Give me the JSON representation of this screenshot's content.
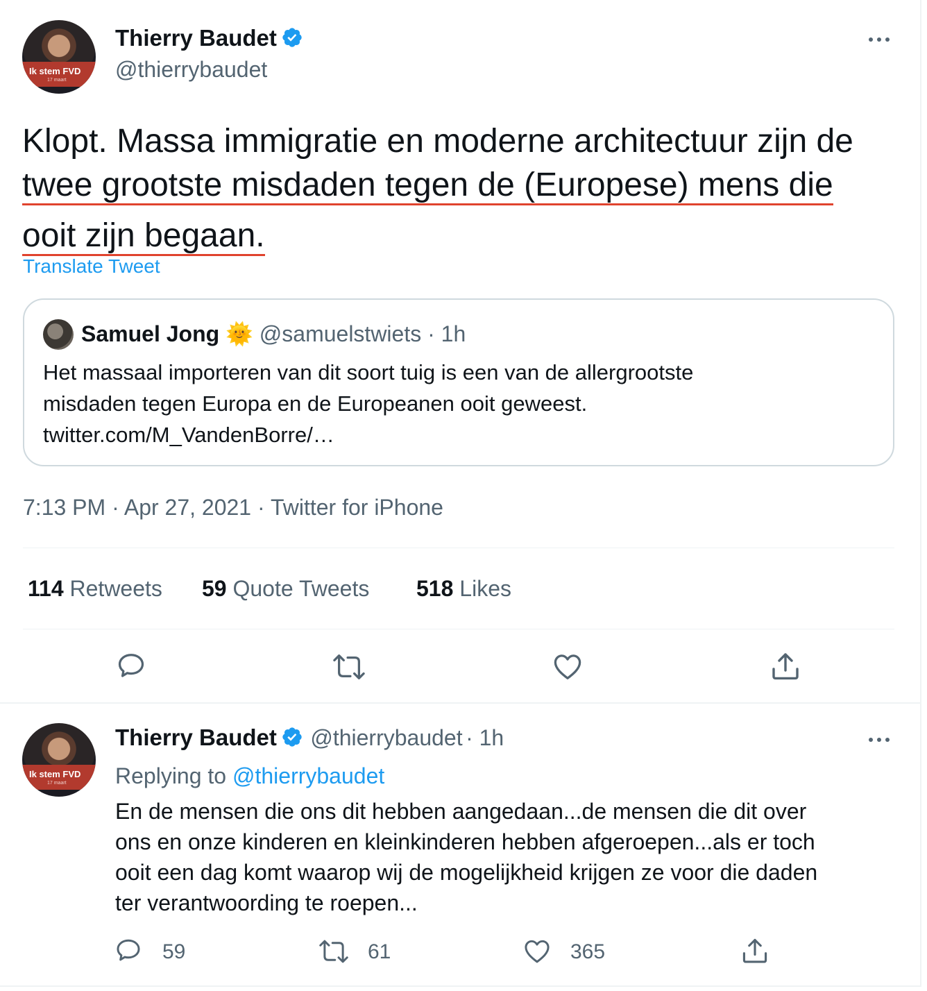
{
  "tweet": {
    "author": {
      "name": "Thierry Baudet",
      "handle": "@thierrybaudet",
      "avatar_text": "Ik stem FVD",
      "avatar_subtext": "17 maart"
    },
    "text_lines": [
      "Klopt. Massa immigratie en moderne architectuur zijn de",
      "twee grootste misdaden tegen de (Europese) mens die",
      "ooit zijn begaan."
    ],
    "translate_label": "Translate Tweet",
    "quote": {
      "name": "Samuel Jong",
      "emoji": "🌞",
      "handle": "@samuelstwiets",
      "time": "· 1h",
      "text_lines": [
        "Het massaal importeren van dit soort tuig is een van de allergrootste",
        "misdaden tegen Europa en de Europeanen ooit geweest.",
        "twitter.com/M_VandenBorre/…"
      ]
    },
    "timestamp": "7:13 PM · Apr 27, 2021 · Twitter for iPhone",
    "stats": {
      "retweets": {
        "count": "114",
        "label": "Retweets"
      },
      "quotes": {
        "count": "59",
        "label": "Quote Tweets"
      },
      "likes": {
        "count": "518",
        "label": "Likes"
      }
    }
  },
  "reply": {
    "name": "Thierry Baudet",
    "handle": "@thierrybaudet",
    "time": "· 1h",
    "avatar_text": "Ik stem FVD",
    "avatar_subtext": "17 maart",
    "replying_prefix": "Replying to",
    "replying_handle": "@thierrybaudet",
    "text_lines": [
      "En de mensen die ons dit hebben aangedaan...de mensen die dit over",
      "ons en onze kinderen en kleinkinderen hebben afgeroepen...als er toch",
      "ooit een dag komt waarop wij de mogelijkheid krijgen ze voor die daden",
      "ter verantwoording te roepen..."
    ],
    "counts": {
      "replies": "59",
      "retweets": "61",
      "likes": "365"
    }
  },
  "colors": {
    "accent": "#1d9bf0",
    "muted": "#536471",
    "underline": "#e0432d",
    "border": "#cfd9de"
  },
  "icons": [
    "verified-badge-icon",
    "more-icon",
    "reply-icon",
    "retweet-icon",
    "like-icon",
    "share-icon"
  ]
}
